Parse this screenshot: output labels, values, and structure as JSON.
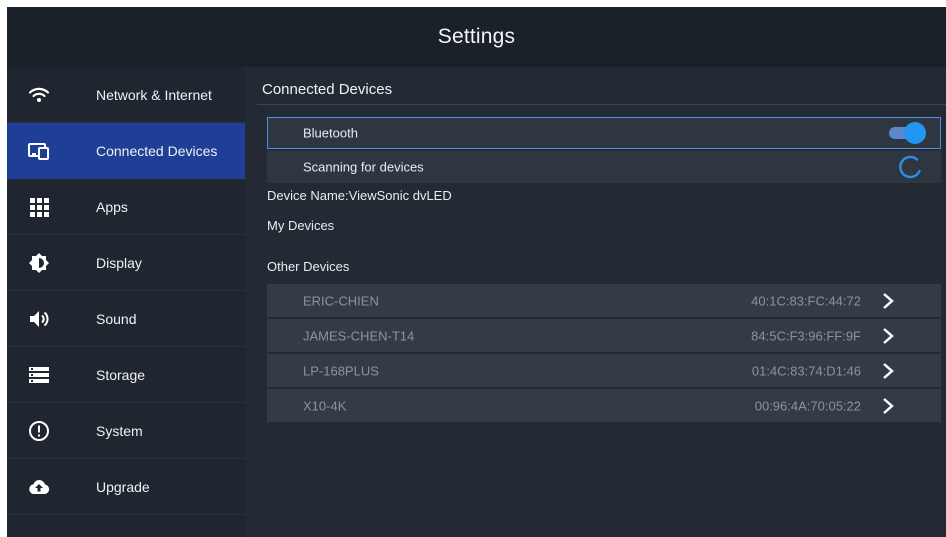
{
  "header": {
    "title": "Settings"
  },
  "sidebar": {
    "items": [
      {
        "label": "Network & Internet",
        "icon": "wifi-icon",
        "active": false
      },
      {
        "label": "Connected Devices",
        "icon": "connected-devices-icon",
        "active": true
      },
      {
        "label": "Apps",
        "icon": "apps-grid-icon",
        "active": false
      },
      {
        "label": "Display",
        "icon": "brightness-icon",
        "active": false
      },
      {
        "label": "Sound",
        "icon": "speaker-icon",
        "active": false
      },
      {
        "label": "Storage",
        "icon": "storage-icon",
        "active": false
      },
      {
        "label": "System",
        "icon": "info-circle-icon",
        "active": false
      },
      {
        "label": "Upgrade",
        "icon": "cloud-upload-icon",
        "active": false
      }
    ]
  },
  "main": {
    "section_title": "Connected Devices",
    "bluetooth": {
      "label": "Bluetooth",
      "enabled": true
    },
    "scanning": {
      "label": "Scanning for devices"
    },
    "device_name": "Device Name:ViewSonic dvLED",
    "my_devices_label": "My Devices",
    "other_devices_label": "Other Devices",
    "other_devices": [
      {
        "name": "ERIC-CHIEN",
        "mac": "40:1C:83:FC:44:72"
      },
      {
        "name": "JAMES-CHEN-T14",
        "mac": "84:5C:F3:96:FF:9F"
      },
      {
        "name": "LP-168PLUS",
        "mac": "01:4C:83:74:D1:46"
      },
      {
        "name": "X10-4K",
        "mac": "00:96:4A:70:05:22"
      }
    ]
  },
  "colors": {
    "accent": "#1f3f96",
    "toggle_on": "#2196f3",
    "background": "#232a34",
    "header_bg": "#1b2129"
  }
}
